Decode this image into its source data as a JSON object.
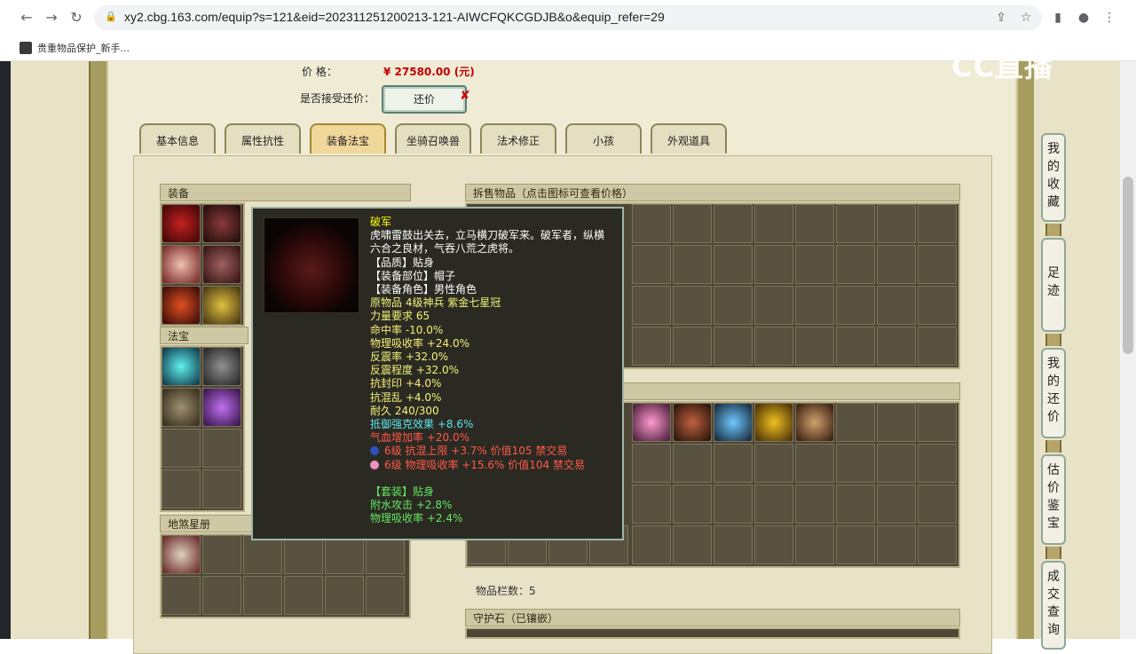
{
  "browser": {
    "url": "xy2.cbg.163.com/equip?s=121&eid=202311251200213-121-AIWCFQKCGDJB&o&equip_refer=29",
    "bookmark": "贵重物品保护_新手..."
  },
  "watermark": "CC直播",
  "price": {
    "label": "价        格：",
    "value": "¥ 27580.00 (元)"
  },
  "haggle": {
    "label": "是否接受还价：",
    "button": "还价"
  },
  "tabs": [
    "基本信息",
    "属性抗性",
    "装备法宝",
    "坐骑召唤兽",
    "法术修正",
    "小孩",
    "外观道具"
  ],
  "active_tab": "装备法宝",
  "sections": {
    "equipment": "装备",
    "fabao": "法宝",
    "star_book": "地煞星册",
    "split_items": "拆售物品（点击图标可查看价格）",
    "item_count": "物品栏数：5",
    "guard_stone": "守护石（已镶嵌）"
  },
  "tooltip": {
    "name": "破军",
    "desc1": "虎啸雷鼓出关去，立马横刀破军来。破军者，纵横",
    "desc2": "六合之良材，气吞八荒之虎将。",
    "quality": "【品质】贴身",
    "slot": "【装备部位】帽子",
    "role": "【装备角色】男性角色",
    "origin": "原物品 4级神兵 紫金七星冠",
    "strength": "力量要求 65",
    "hit": "命中率 -10.0%",
    "phys_absorb": "物理吸收率 +24.0%",
    "reflect_rate": "反震率 +32.0%",
    "reflect_deg": "反震程度 +32.0%",
    "res_seal": "抗封印 +4.0%",
    "res_chaos": "抗混乱 +4.0%",
    "durability": "耐久 240/300",
    "resist_effect": "抵御强克效果 +8.6%",
    "hp_bonus": "气血增加率 +20.0%",
    "gem1": "6级 抗混上限 +3.7% 价值105 禁交易",
    "gem2": "6级 物理吸收率 +15.6% 价值104 禁交易",
    "set": "【套装】贴身",
    "set1": "附水攻击 +2.8%",
    "set2": "物理吸收率 +2.4%"
  },
  "sidebar": [
    "我的收藏",
    "足迹",
    "我的还价",
    "估价鉴宝",
    "成交查询"
  ]
}
